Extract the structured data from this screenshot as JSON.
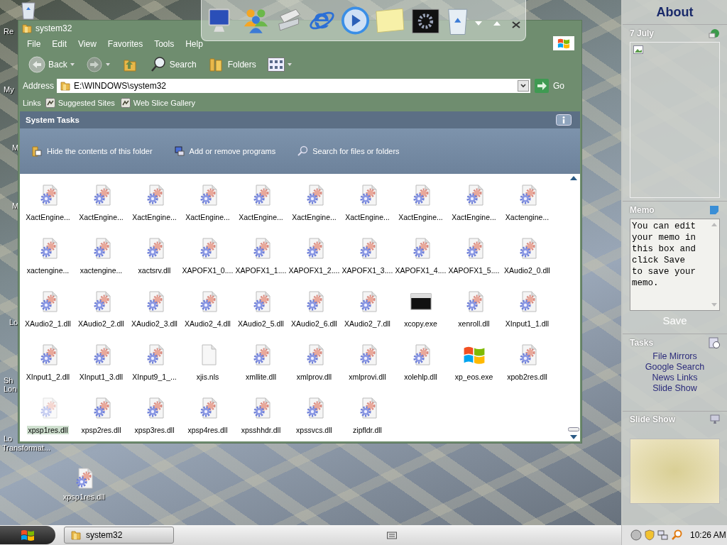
{
  "desktop": {
    "edge_labels": [
      {
        "label": "Re"
      },
      {
        "label": "My"
      },
      {
        "label": "M"
      },
      {
        "label": "M"
      },
      {
        "label": "Lo"
      },
      {
        "label": "Sh"
      },
      {
        "label": "Lon"
      },
      {
        "label": "Lo"
      },
      {
        "label": "Transformat..."
      }
    ],
    "icons": [
      {
        "label": "xpsp1res.dll",
        "kind": "dll"
      }
    ]
  },
  "window": {
    "title": "system32"
  },
  "menu": [
    "File",
    "Edit",
    "View",
    "Favorites",
    "Tools",
    "Help"
  ],
  "toolbar": [
    {
      "kind": "back",
      "label": "Back"
    },
    {
      "kind": "forward"
    },
    {
      "kind": "up"
    },
    {
      "kind": "search",
      "label": "Search"
    },
    {
      "kind": "folders",
      "label": "Folders"
    },
    {
      "kind": "views"
    }
  ],
  "address": {
    "label": "Address",
    "value": "E:\\WINDOWS\\system32",
    "go": "Go"
  },
  "links": {
    "label": "Links",
    "items": [
      "Suggested Sites",
      "Web Slice Gallery"
    ]
  },
  "system_tasks": {
    "title": "System Tasks",
    "items": [
      {
        "kind": "hide",
        "label": "Hide the contents of this folder"
      },
      {
        "kind": "programs",
        "label": "Add or remove programs"
      },
      {
        "kind": "search",
        "label": "Search for files or folders"
      }
    ]
  },
  "files": [
    {
      "name": "XactEngine...",
      "kind": "dll",
      "selected": false
    },
    {
      "name": "XactEngine...",
      "kind": "dll",
      "selected": false
    },
    {
      "name": "XactEngine...",
      "kind": "dll",
      "selected": false
    },
    {
      "name": "XactEngine...",
      "kind": "dll",
      "selected": false
    },
    {
      "name": "XactEngine...",
      "kind": "dll",
      "selected": false
    },
    {
      "name": "XactEngine...",
      "kind": "dll",
      "selected": false
    },
    {
      "name": "XactEngine...",
      "kind": "dll",
      "selected": false
    },
    {
      "name": "XactEngine...",
      "kind": "dll",
      "selected": false
    },
    {
      "name": "XactEngine...",
      "kind": "dll",
      "selected": false
    },
    {
      "name": "Xactengine...",
      "kind": "dll",
      "selected": false
    },
    {
      "name": "xactengine...",
      "kind": "dll",
      "selected": false
    },
    {
      "name": "xactengine...",
      "kind": "dll",
      "selected": false
    },
    {
      "name": "xactsrv.dll",
      "kind": "dll",
      "selected": false
    },
    {
      "name": "XAPOFX1_0....",
      "kind": "dll",
      "selected": false
    },
    {
      "name": "XAPOFX1_1....",
      "kind": "dll",
      "selected": false
    },
    {
      "name": "XAPOFX1_2....",
      "kind": "dll",
      "selected": false
    },
    {
      "name": "XAPOFX1_3....",
      "kind": "dll",
      "selected": false
    },
    {
      "name": "XAPOFX1_4....",
      "kind": "dll",
      "selected": false
    },
    {
      "name": "XAPOFX1_5....",
      "kind": "dll",
      "selected": false
    },
    {
      "name": "XAudio2_0.dll",
      "kind": "dll",
      "selected": false
    },
    {
      "name": "XAudio2_1.dll",
      "kind": "dll",
      "selected": false
    },
    {
      "name": "XAudio2_2.dll",
      "kind": "dll",
      "selected": false
    },
    {
      "name": "XAudio2_3.dll",
      "kind": "dll",
      "selected": false
    },
    {
      "name": "XAudio2_4.dll",
      "kind": "dll",
      "selected": false
    },
    {
      "name": "XAudio2_5.dll",
      "kind": "dll",
      "selected": false
    },
    {
      "name": "XAudio2_6.dll",
      "kind": "dll",
      "selected": false
    },
    {
      "name": "XAudio2_7.dll",
      "kind": "dll",
      "selected": false
    },
    {
      "name": "xcopy.exe",
      "kind": "console",
      "selected": false
    },
    {
      "name": "xenroll.dll",
      "kind": "dll",
      "selected": false
    },
    {
      "name": "XInput1_1.dll",
      "kind": "dll",
      "selected": false
    },
    {
      "name": "XInput1_2.dll",
      "kind": "dll",
      "selected": false
    },
    {
      "name": "XInput1_3.dll",
      "kind": "dll",
      "selected": false
    },
    {
      "name": "XInput9_1_...",
      "kind": "dll",
      "selected": false
    },
    {
      "name": "xjis.nls",
      "kind": "blank",
      "selected": false
    },
    {
      "name": "xmllite.dll",
      "kind": "dll",
      "selected": false
    },
    {
      "name": "xmlprov.dll",
      "kind": "dll",
      "selected": false
    },
    {
      "name": "xmlprovi.dll",
      "kind": "dll",
      "selected": false
    },
    {
      "name": "xolehlp.dll",
      "kind": "dll",
      "selected": false
    },
    {
      "name": "xp_eos.exe",
      "kind": "windows",
      "selected": false
    },
    {
      "name": "xpob2res.dll",
      "kind": "dll",
      "selected": false
    },
    {
      "name": "xpsp1res.dll",
      "kind": "dll",
      "selected": true
    },
    {
      "name": "xpsp2res.dll",
      "kind": "dll",
      "selected": false
    },
    {
      "name": "xpsp3res.dll",
      "kind": "dll",
      "selected": false
    },
    {
      "name": "xpsp4res.dll",
      "kind": "dll",
      "selected": false
    },
    {
      "name": "xpsshhdr.dll",
      "kind": "dll",
      "selected": false
    },
    {
      "name": "xpssvcs.dll",
      "kind": "dll",
      "selected": false
    },
    {
      "name": "zipfldr.dll",
      "kind": "dll",
      "selected": false
    }
  ],
  "sidebar": {
    "title": "About",
    "date": "7 July",
    "memo": {
      "title": "Memo",
      "text": "You can edit your memo in this box and click Save to save your memo.",
      "save": "Save"
    },
    "tasks": {
      "title": "Tasks",
      "items": [
        "File Mirrors",
        "Google Search",
        "News Links",
        "Slide Show"
      ]
    },
    "slideshow": {
      "title": "Slide Show"
    }
  },
  "taskbar": {
    "task": "system32",
    "clock": "10:26 AM"
  }
}
